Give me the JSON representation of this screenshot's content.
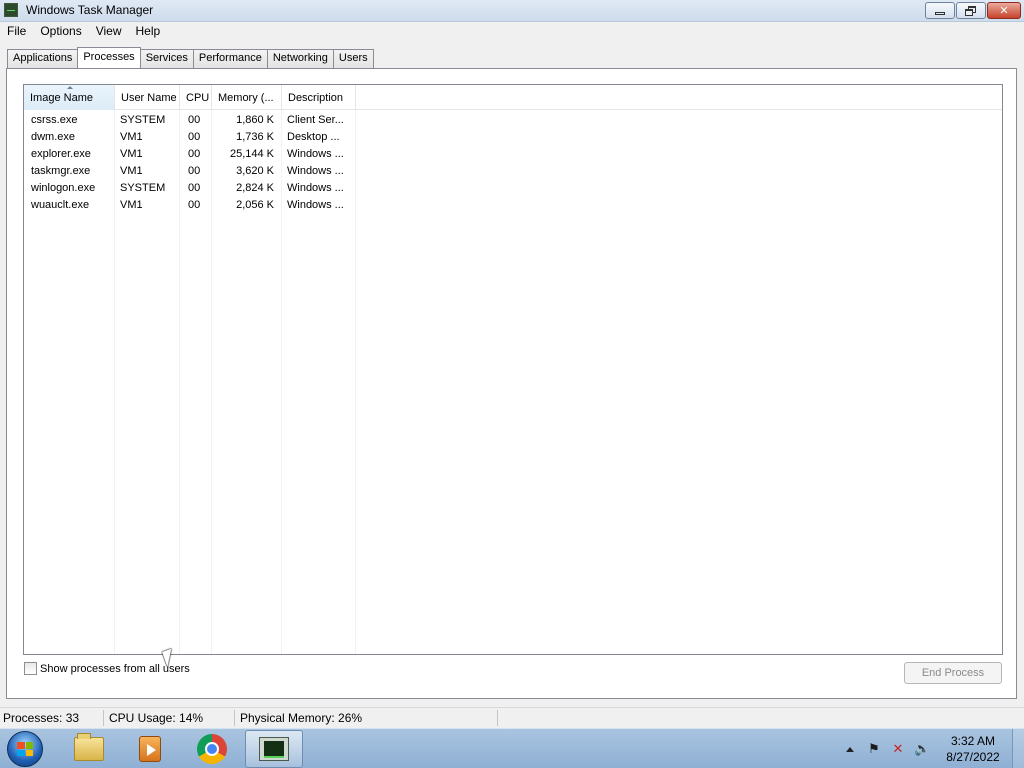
{
  "window": {
    "title": "Windows Task Manager",
    "controls": {
      "minimize_icon": "minimize-icon",
      "restore_icon": "restore-icon",
      "close_icon": "close-icon",
      "close_glyph": "✕"
    }
  },
  "menu": [
    "File",
    "Options",
    "View",
    "Help"
  ],
  "tabs": [
    {
      "label": "Applications",
      "active": false
    },
    {
      "label": "Processes",
      "active": true
    },
    {
      "label": "Services",
      "active": false
    },
    {
      "label": "Performance",
      "active": false
    },
    {
      "label": "Networking",
      "active": false
    },
    {
      "label": "Users",
      "active": false
    }
  ],
  "process_list": {
    "columns": [
      "Image Name",
      "User Name",
      "CPU",
      "Memory (...",
      "Description"
    ],
    "sorted_column": "Image Name",
    "rows": [
      {
        "image": "csrss.exe",
        "user": "SYSTEM",
        "cpu": "00",
        "memory": "1,860 K",
        "description": "Client Ser..."
      },
      {
        "image": "dwm.exe",
        "user": "VM1",
        "cpu": "00",
        "memory": "1,736 K",
        "description": "Desktop ..."
      },
      {
        "image": "explorer.exe",
        "user": "VM1",
        "cpu": "00",
        "memory": "25,144 K",
        "description": "Windows ..."
      },
      {
        "image": "taskmgr.exe",
        "user": "VM1",
        "cpu": "00",
        "memory": "3,620 K",
        "description": "Windows ..."
      },
      {
        "image": "winlogon.exe",
        "user": "SYSTEM",
        "cpu": "00",
        "memory": "2,824 K",
        "description": "Windows ..."
      },
      {
        "image": "wuauclt.exe",
        "user": "VM1",
        "cpu": "00",
        "memory": "2,056 K",
        "description": "Windows ..."
      }
    ]
  },
  "show_all_users": {
    "label": "Show processes from all users",
    "checked": false
  },
  "end_process": {
    "label": "End Process",
    "enabled": false
  },
  "status": {
    "processes": "Processes: 33",
    "cpu": "CPU Usage: 14%",
    "memory": "Physical Memory: 26%"
  },
  "taskbar": {
    "pinned": [
      "windows-explorer-icon",
      "media-player-icon",
      "chrome-icon",
      "task-manager-icon"
    ],
    "clock_time": "3:32 AM",
    "clock_date": "8/27/2022"
  }
}
